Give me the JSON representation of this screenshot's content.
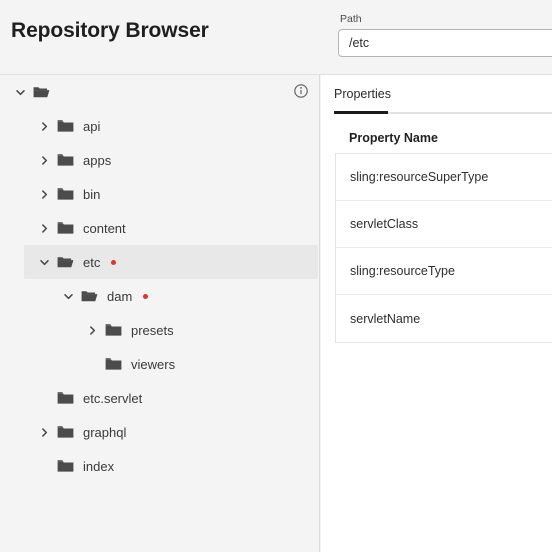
{
  "header": {
    "title": "Repository Browser",
    "path_label": "Path",
    "path_value": "/etc",
    "path_placeholder": "/"
  },
  "tree_panel": {
    "info_icon": "info-icon",
    "nodes": [
      {
        "label": "",
        "level": 0,
        "expanded": true,
        "has_children": true,
        "folder": "open",
        "badge": false
      },
      {
        "label": "api",
        "level": 1,
        "expanded": false,
        "has_children": true,
        "folder": "closed",
        "badge": false
      },
      {
        "label": "apps",
        "level": 1,
        "expanded": false,
        "has_children": true,
        "folder": "closed",
        "badge": false
      },
      {
        "label": "bin",
        "level": 1,
        "expanded": false,
        "has_children": true,
        "folder": "closed",
        "badge": false
      },
      {
        "label": "content",
        "level": 1,
        "expanded": false,
        "has_children": true,
        "folder": "closed",
        "badge": false
      },
      {
        "label": "etc",
        "level": 1,
        "expanded": true,
        "has_children": true,
        "folder": "open",
        "badge": true,
        "selected": true
      },
      {
        "label": "dam",
        "level": 2,
        "expanded": true,
        "has_children": true,
        "folder": "open",
        "badge": true
      },
      {
        "label": "presets",
        "level": 3,
        "expanded": false,
        "has_children": true,
        "folder": "closed",
        "badge": false
      },
      {
        "label": "viewers",
        "level": 3,
        "expanded": false,
        "has_children": false,
        "folder": "closed",
        "badge": false
      },
      {
        "label": "etc.servlet",
        "level": 1,
        "expanded": false,
        "has_children": false,
        "folder": "closed",
        "badge": false
      },
      {
        "label": "graphql",
        "level": 1,
        "expanded": false,
        "has_children": true,
        "folder": "closed",
        "badge": false
      },
      {
        "label": "index",
        "level": 1,
        "expanded": false,
        "has_children": false,
        "folder": "closed",
        "badge": false
      }
    ]
  },
  "properties_panel": {
    "tabs": [
      {
        "label": "Properties",
        "active": true
      }
    ],
    "column_header": "Property Name",
    "rows": [
      {
        "name": "sling:resourceSuperType"
      },
      {
        "name": "servletClass"
      },
      {
        "name": "sling:resourceType"
      },
      {
        "name": "servletName"
      }
    ]
  },
  "colors": {
    "badge": "#d7372f",
    "selected_row": "#e8e8e8",
    "tab_active_underline": "#1b1b1b",
    "panel_bg": "#f4f4f4",
    "content_bg": "#ffffff"
  }
}
